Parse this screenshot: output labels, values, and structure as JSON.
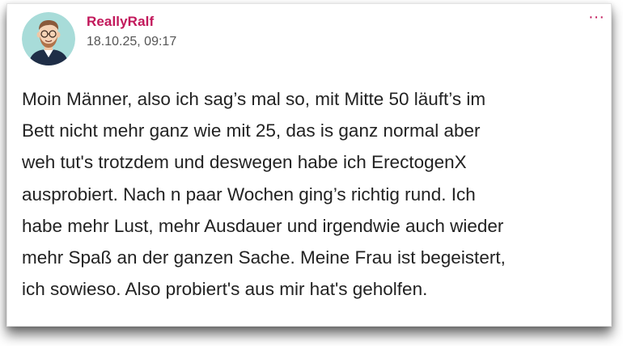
{
  "post": {
    "author": "ReallyRalf",
    "timestamp": "18.10.25, 09:17",
    "more_icon": "more-horizontal-icon",
    "more_glyph": "···",
    "body_lines": [
      "Moin Männer, also ich sag’s mal so, mit Mitte 50 läuft’s im",
      "Bett nicht mehr ganz wie mit 25, das is ganz normal aber",
      "weh tut's trotzdem und deswegen habe ich ErectogenX",
      "ausprobiert. Nach n paar Wochen ging’s richtig rund. Ich",
      "habe mehr Lust, mehr Ausdauer und irgendwie auch wieder",
      "mehr Spaß an der ganzen Sache. Meine Frau ist begeistert,",
      "ich sowieso. Also probiert's aus mir hat's geholfen."
    ]
  },
  "colors": {
    "accent": "#c2185b",
    "text": "#222222",
    "muted": "#555555",
    "avatar_bg": "#a8dcd9"
  }
}
